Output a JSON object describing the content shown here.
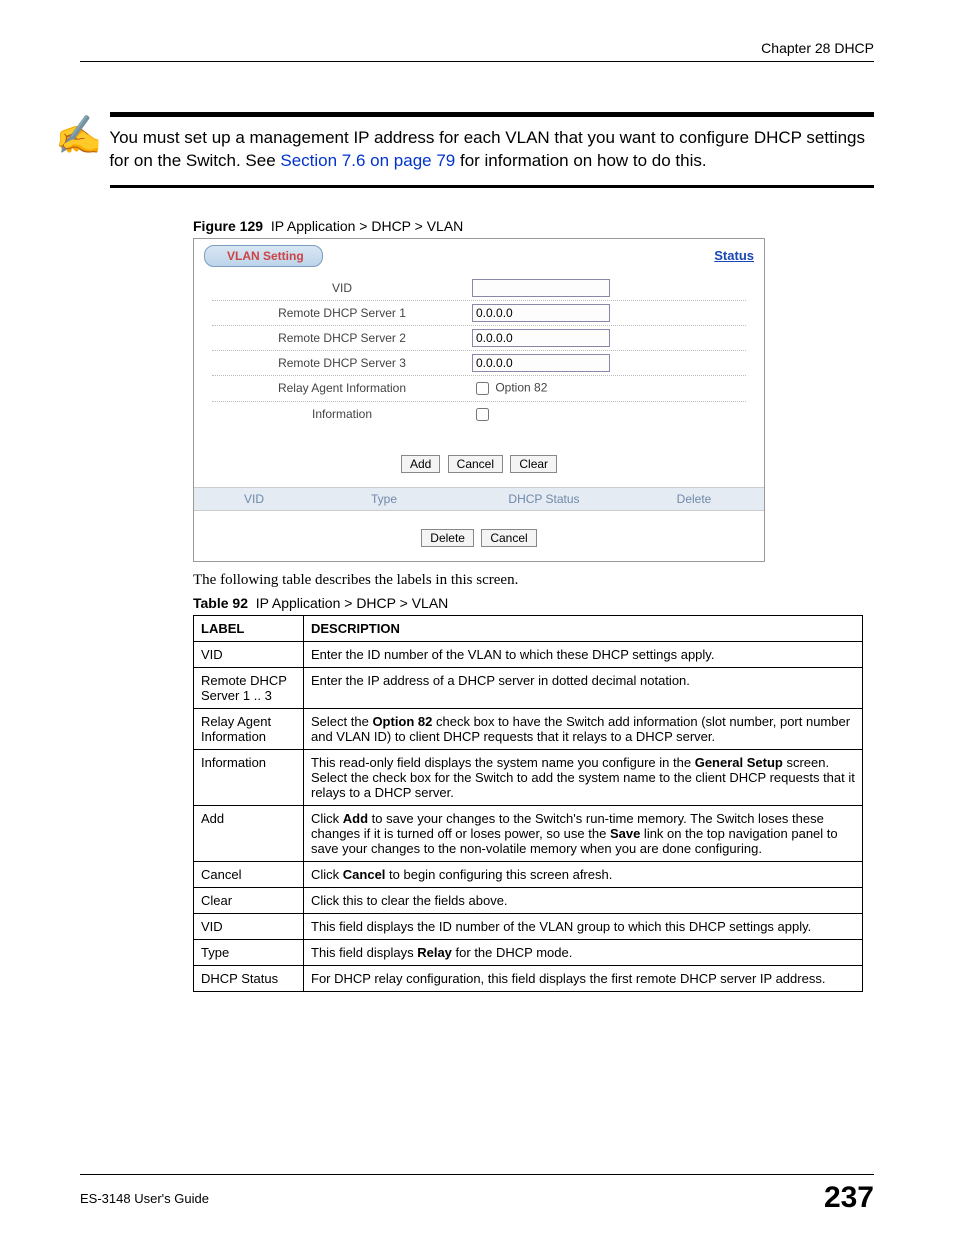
{
  "header": {
    "chapter": "Chapter 28 DHCP"
  },
  "note": {
    "text_pre": "You must set up a management IP address for each VLAN that you want to configure DHCP settings for on the Switch. See ",
    "link": "Section 7.6 on page 79",
    "text_post": " for information on how to do this."
  },
  "figure": {
    "label": "Figure 129",
    "caption": "IP Application > DHCP > VLAN"
  },
  "screenshot": {
    "tab": "VLAN Setting",
    "status_link": "Status",
    "rows": {
      "vid_label": "VID",
      "vid_value": "",
      "server1_label": "Remote DHCP Server 1",
      "server1_value": "0.0.0.0",
      "server2_label": "Remote DHCP Server 2",
      "server2_value": "0.0.0.0",
      "server3_label": "Remote DHCP Server 3",
      "server3_value": "0.0.0.0",
      "relay_label": "Relay Agent Information",
      "relay_checkbox_label": "Option 82",
      "info_label": "Information",
      "info_value": ""
    },
    "buttons": {
      "add": "Add",
      "cancel": "Cancel",
      "clear": "Clear"
    },
    "table_headers": {
      "vid": "VID",
      "type": "Type",
      "dhcp_status": "DHCP Status",
      "delete": "Delete"
    },
    "buttons2": {
      "delete": "Delete",
      "cancel": "Cancel"
    }
  },
  "intro": "The following table describes the labels in this screen.",
  "table_caption": {
    "label": "Table 92",
    "caption": "IP Application > DHCP > VLAN"
  },
  "table": {
    "head_label": "LABEL",
    "head_desc": "DESCRIPTION",
    "rows": [
      {
        "label": "VID",
        "desc": "Enter the ID number of the VLAN to which these DHCP settings apply."
      },
      {
        "label": "Remote DHCP Server 1 .. 3",
        "desc": "Enter the IP address of a DHCP server in dotted decimal notation."
      },
      {
        "label": "Relay Agent Information",
        "desc": "Select the <b>Option 82</b> check box to have the Switch add information (slot number, port number and VLAN ID) to client DHCP requests that it relays to a DHCP server."
      },
      {
        "label": "Information",
        "desc": "This read-only field displays the system name you configure in the <b>General Setup</b> screen.<br>Select the check box for the Switch to add the system name to the client DHCP requests that it relays to a DHCP server."
      },
      {
        "label": "Add",
        "desc": "Click <b>Add</b> to save your changes to the Switch's run-time memory. The Switch loses these changes if it is turned off or loses power, so use the <b>Save</b> link on the top navigation panel to save your changes to the non-volatile memory when you are done configuring."
      },
      {
        "label": "Cancel",
        "desc": "Click <b>Cancel</b> to begin configuring this screen afresh."
      },
      {
        "label": "Clear",
        "desc": "Click this to clear the fields above."
      },
      {
        "label": "VID",
        "desc": "This field displays the ID number of the VLAN group to which this DHCP settings apply."
      },
      {
        "label": "Type",
        "desc": "This field displays <b>Relay</b> for the DHCP mode."
      },
      {
        "label": "DHCP Status",
        "desc": "For DHCP relay configuration, this field displays the first remote DHCP server IP address."
      }
    ]
  },
  "footer": {
    "left": "ES-3148 User's Guide",
    "page": "237"
  }
}
